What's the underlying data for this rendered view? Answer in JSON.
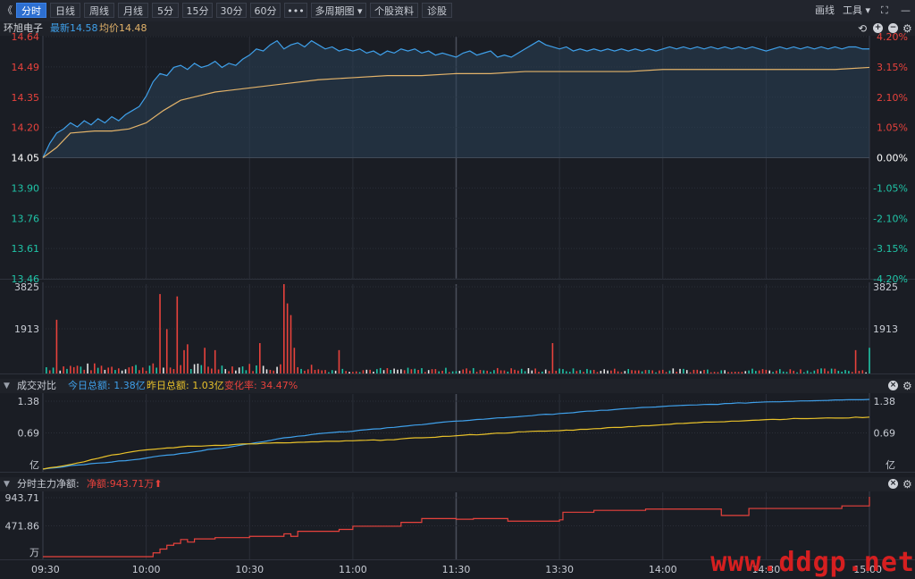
{
  "toolbar": {
    "collapse_glyph": "《",
    "tabs": [
      "分时",
      "日线",
      "周线",
      "月线",
      "5分",
      "15分",
      "30分",
      "60分",
      "•••",
      "多周期图 ▾",
      "个股资料",
      "诊股"
    ],
    "active_tab": 0,
    "draw_label": "画线",
    "tools_label": "工具 ▾",
    "expand_glyph": "⛶",
    "minimize_glyph": "—"
  },
  "stock": {
    "name": "环旭电子",
    "latest_label": "最新14.58",
    "avg_label": "均价14.48"
  },
  "panel_volume": {},
  "panel_turnover": {
    "title": "成交对比",
    "today_label": "今日总额: 1.38亿",
    "yesterday_label": "昨日总额: 1.03亿",
    "change_label": "变化率: 34.47%"
  },
  "panel_mainforce": {
    "title": "分时主力净额:",
    "value_label": "净额:943.71万⬆"
  },
  "watermark": "www.ddgp.net",
  "colors": {
    "bg": "#1a1d24",
    "grid": "#2b2f38",
    "price": "#3fa0ea",
    "avg": "#e3b36a",
    "up": "#e8423c",
    "down": "#1fc4a7",
    "yellow": "#e8c12a",
    "white": "#e6e6e6"
  },
  "chart_data": [
    {
      "type": "line",
      "name": "price",
      "x_ticks": [
        "09:30",
        "10:00",
        "10:30",
        "11:00",
        "11:30",
        "13:30",
        "14:00",
        "14:30",
        "15:00"
      ],
      "y_left_ticks": [
        "14.64",
        "14.49",
        "14.35",
        "14.20",
        "14.05",
        "13.90",
        "13.76",
        "13.61",
        "13.46"
      ],
      "y_right_ticks": [
        "4.20%",
        "3.15%",
        "2.10%",
        "1.05%",
        "0.00%",
        "-1.05%",
        "-2.10%",
        "-3.15%",
        "-4.20%"
      ],
      "ylim": [
        13.46,
        14.64
      ],
      "base_price": 14.05,
      "series": [
        {
          "name": "最新",
          "points": [
            [
              0,
              14.05
            ],
            [
              2,
              14.12
            ],
            [
              4,
              14.17
            ],
            [
              6,
              14.19
            ],
            [
              8,
              14.22
            ],
            [
              10,
              14.2
            ],
            [
              12,
              14.23
            ],
            [
              14,
              14.21
            ],
            [
              16,
              14.24
            ],
            [
              18,
              14.22
            ],
            [
              20,
              14.25
            ],
            [
              22,
              14.23
            ],
            [
              24,
              14.26
            ],
            [
              26,
              14.28
            ],
            [
              28,
              14.3
            ],
            [
              30,
              14.35
            ],
            [
              32,
              14.42
            ],
            [
              34,
              14.46
            ],
            [
              36,
              14.45
            ],
            [
              38,
              14.49
            ],
            [
              40,
              14.5
            ],
            [
              42,
              14.48
            ],
            [
              44,
              14.51
            ],
            [
              46,
              14.49
            ],
            [
              48,
              14.5
            ],
            [
              50,
              14.52
            ],
            [
              52,
              14.49
            ],
            [
              54,
              14.51
            ],
            [
              56,
              14.5
            ],
            [
              58,
              14.53
            ],
            [
              60,
              14.55
            ],
            [
              62,
              14.58
            ],
            [
              64,
              14.57
            ],
            [
              66,
              14.6
            ],
            [
              68,
              14.62
            ],
            [
              70,
              14.58
            ],
            [
              72,
              14.6
            ],
            [
              74,
              14.61
            ],
            [
              76,
              14.59
            ],
            [
              78,
              14.62
            ],
            [
              80,
              14.6
            ],
            [
              82,
              14.58
            ],
            [
              84,
              14.59
            ],
            [
              86,
              14.57
            ],
            [
              88,
              14.58
            ],
            [
              90,
              14.57
            ],
            [
              92,
              14.58
            ],
            [
              94,
              14.56
            ],
            [
              96,
              14.57
            ],
            [
              98,
              14.55
            ],
            [
              100,
              14.57
            ],
            [
              102,
              14.56
            ],
            [
              104,
              14.58
            ],
            [
              106,
              14.57
            ],
            [
              108,
              14.58
            ],
            [
              110,
              14.56
            ],
            [
              112,
              14.57
            ],
            [
              114,
              14.55
            ],
            [
              116,
              14.56
            ],
            [
              118,
              14.55
            ],
            [
              120,
              14.54
            ],
            [
              122,
              14.56
            ],
            [
              124,
              14.57
            ],
            [
              126,
              14.55
            ],
            [
              128,
              14.56
            ],
            [
              130,
              14.57
            ],
            [
              132,
              14.54
            ],
            [
              134,
              14.55
            ],
            [
              136,
              14.54
            ],
            [
              138,
              14.56
            ],
            [
              140,
              14.58
            ],
            [
              142,
              14.6
            ],
            [
              144,
              14.62
            ],
            [
              146,
              14.6
            ],
            [
              148,
              14.59
            ],
            [
              150,
              14.58
            ],
            [
              152,
              14.59
            ],
            [
              154,
              14.57
            ],
            [
              156,
              14.58
            ],
            [
              158,
              14.57
            ],
            [
              160,
              14.58
            ],
            [
              162,
              14.57
            ],
            [
              164,
              14.58
            ],
            [
              166,
              14.57
            ],
            [
              168,
              14.58
            ],
            [
              170,
              14.57
            ],
            [
              172,
              14.58
            ],
            [
              174,
              14.57
            ],
            [
              176,
              14.58
            ],
            [
              178,
              14.57
            ],
            [
              180,
              14.58
            ],
            [
              182,
              14.59
            ],
            [
              184,
              14.58
            ],
            [
              186,
              14.59
            ],
            [
              188,
              14.58
            ],
            [
              190,
              14.59
            ],
            [
              192,
              14.58
            ],
            [
              194,
              14.59
            ],
            [
              196,
              14.58
            ],
            [
              198,
              14.59
            ],
            [
              200,
              14.58
            ],
            [
              202,
              14.59
            ],
            [
              204,
              14.58
            ],
            [
              206,
              14.59
            ],
            [
              208,
              14.58
            ],
            [
              210,
              14.57
            ],
            [
              212,
              14.58
            ],
            [
              214,
              14.59
            ],
            [
              216,
              14.58
            ],
            [
              218,
              14.59
            ],
            [
              220,
              14.58
            ],
            [
              222,
              14.59
            ],
            [
              224,
              14.58
            ],
            [
              226,
              14.59
            ],
            [
              228,
              14.58
            ],
            [
              230,
              14.59
            ],
            [
              232,
              14.58
            ],
            [
              234,
              14.59
            ],
            [
              236,
              14.59
            ],
            [
              238,
              14.58
            ],
            [
              240,
              14.58
            ]
          ]
        },
        {
          "name": "均价",
          "points": [
            [
              0,
              14.05
            ],
            [
              4,
              14.1
            ],
            [
              8,
              14.17
            ],
            [
              15,
              14.18
            ],
            [
              20,
              14.18
            ],
            [
              25,
              14.19
            ],
            [
              30,
              14.22
            ],
            [
              35,
              14.28
            ],
            [
              40,
              14.33
            ],
            [
              45,
              14.35
            ],
            [
              50,
              14.37
            ],
            [
              60,
              14.39
            ],
            [
              70,
              14.41
            ],
            [
              80,
              14.43
            ],
            [
              90,
              14.44
            ],
            [
              100,
              14.45
            ],
            [
              110,
              14.45
            ],
            [
              120,
              14.46
            ],
            [
              130,
              14.46
            ],
            [
              140,
              14.47
            ],
            [
              150,
              14.47
            ],
            [
              160,
              14.47
            ],
            [
              170,
              14.47
            ],
            [
              180,
              14.48
            ],
            [
              190,
              14.48
            ],
            [
              200,
              14.48
            ],
            [
              210,
              14.48
            ],
            [
              220,
              14.48
            ],
            [
              230,
              14.48
            ],
            [
              240,
              14.49
            ]
          ]
        }
      ]
    },
    {
      "type": "bar",
      "name": "volume",
      "y_ticks": [
        "3825",
        "1913"
      ],
      "ylim": [
        0,
        3825
      ],
      "peaks": [
        [
          4,
          2300,
          "up"
        ],
        [
          34,
          3400,
          "up"
        ],
        [
          36,
          1900,
          "up"
        ],
        [
          39,
          3300,
          "up"
        ],
        [
          41,
          1000,
          "up"
        ],
        [
          42,
          1250,
          "up"
        ],
        [
          47,
          1100,
          "up"
        ],
        [
          50,
          1000,
          "up"
        ],
        [
          63,
          1300,
          "up"
        ],
        [
          70,
          3825,
          "up"
        ],
        [
          71,
          3000,
          "up"
        ],
        [
          72,
          2500,
          "up"
        ],
        [
          73,
          1100,
          "up"
        ],
        [
          86,
          1000,
          "up"
        ],
        [
          148,
          1300,
          "up"
        ],
        [
          236,
          1000,
          "up"
        ],
        [
          240,
          1100,
          "down"
        ]
      ]
    },
    {
      "type": "line",
      "name": "turnover",
      "y_ticks": [
        "1.38",
        "0.69",
        "亿"
      ],
      "ylim": [
        0,
        1.38
      ],
      "series": [
        {
          "name": "今日总额",
          "points": [
            [
              0,
              0
            ],
            [
              10,
              0.08
            ],
            [
              20,
              0.14
            ],
            [
              30,
              0.22
            ],
            [
              40,
              0.31
            ],
            [
              50,
              0.4
            ],
            [
              60,
              0.5
            ],
            [
              70,
              0.62
            ],
            [
              80,
              0.7
            ],
            [
              90,
              0.75
            ],
            [
              100,
              0.82
            ],
            [
              110,
              0.88
            ],
            [
              120,
              0.95
            ],
            [
              130,
              1.0
            ],
            [
              140,
              1.05
            ],
            [
              150,
              1.1
            ],
            [
              160,
              1.15
            ],
            [
              170,
              1.2
            ],
            [
              180,
              1.24
            ],
            [
              190,
              1.27
            ],
            [
              200,
              1.3
            ],
            [
              210,
              1.33
            ],
            [
              220,
              1.35
            ],
            [
              230,
              1.37
            ],
            [
              240,
              1.38
            ]
          ]
        },
        {
          "name": "昨日总额",
          "points": [
            [
              0,
              0
            ],
            [
              10,
              0.12
            ],
            [
              20,
              0.28
            ],
            [
              30,
              0.38
            ],
            [
              40,
              0.44
            ],
            [
              50,
              0.47
            ],
            [
              60,
              0.5
            ],
            [
              70,
              0.52
            ],
            [
              80,
              0.54
            ],
            [
              90,
              0.56
            ],
            [
              100,
              0.58
            ],
            [
              110,
              0.62
            ],
            [
              120,
              0.66
            ],
            [
              130,
              0.7
            ],
            [
              140,
              0.74
            ],
            [
              150,
              0.76
            ],
            [
              160,
              0.8
            ],
            [
              170,
              0.84
            ],
            [
              180,
              0.88
            ],
            [
              190,
              0.92
            ],
            [
              200,
              0.95
            ],
            [
              210,
              0.98
            ],
            [
              220,
              1.0
            ],
            [
              230,
              1.01
            ],
            [
              240,
              1.03
            ]
          ]
        }
      ]
    },
    {
      "type": "line",
      "name": "mainforce",
      "y_ticks": [
        "943.71",
        "471.86",
        "万"
      ],
      "ylim": [
        0,
        943.71
      ],
      "series": [
        {
          "name": "净额",
          "points": [
            [
              0,
              0
            ],
            [
              30,
              0
            ],
            [
              32,
              60
            ],
            [
              34,
              120
            ],
            [
              36,
              180
            ],
            [
              38,
              210
            ],
            [
              40,
              270
            ],
            [
              42,
              230
            ],
            [
              44,
              280
            ],
            [
              50,
              300
            ],
            [
              60,
              320
            ],
            [
              70,
              360
            ],
            [
              72,
              320
            ],
            [
              74,
              400
            ],
            [
              86,
              430
            ],
            [
              90,
              480
            ],
            [
              104,
              540
            ],
            [
              110,
              600
            ],
            [
              120,
              590
            ],
            [
              125,
              600
            ],
            [
              135,
              560
            ],
            [
              150,
              580
            ],
            [
              151,
              700
            ],
            [
              160,
              730
            ],
            [
              175,
              750
            ],
            [
              195,
              750
            ],
            [
              197,
              650
            ],
            [
              203,
              650
            ],
            [
              205,
              760
            ],
            [
              230,
              760
            ],
            [
              232,
              800
            ],
            [
              240,
              943.71
            ]
          ]
        }
      ]
    }
  ]
}
